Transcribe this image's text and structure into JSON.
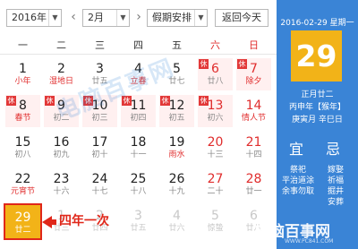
{
  "toolbar": {
    "year_value": "2016年",
    "prev_icon": "chevron-left-icon",
    "month_value": "2月",
    "next_icon": "chevron-right-icon",
    "holiday_value": "假期安排",
    "today_label": "返回今天"
  },
  "weekdays": [
    "一",
    "二",
    "三",
    "四",
    "五",
    "六",
    "日"
  ],
  "days": [
    [
      {
        "num": "1",
        "sub": "小年",
        "sub_red": true
      },
      {
        "num": "2",
        "sub": "湿地日",
        "sub_red": true
      },
      {
        "num": "3",
        "sub": "廿五"
      },
      {
        "num": "4",
        "sub": "立春",
        "sub_red": true
      },
      {
        "num": "5",
        "sub": "廿七"
      },
      {
        "num": "6",
        "sub": "廿八",
        "tag": "休",
        "weekend": true,
        "holiday": true
      },
      {
        "num": "7",
        "sub": "除夕",
        "sub_red": true,
        "tag": "休",
        "weekend": true,
        "holiday": true
      }
    ],
    [
      {
        "num": "8",
        "sub": "春节",
        "sub_red": true,
        "tag": "休",
        "holiday": true
      },
      {
        "num": "9",
        "sub": "初二",
        "tag": "休",
        "holiday": true
      },
      {
        "num": "10",
        "sub": "初三",
        "tag": "休",
        "holiday": true
      },
      {
        "num": "11",
        "sub": "初四",
        "tag": "休",
        "holiday": true
      },
      {
        "num": "12",
        "sub": "初五",
        "tag": "休",
        "holiday": true
      },
      {
        "num": "13",
        "sub": "初六",
        "tag": "休",
        "weekend": true,
        "holiday": true
      },
      {
        "num": "14",
        "sub": "情人节",
        "sub_red": true,
        "weekend": true
      }
    ],
    [
      {
        "num": "15",
        "sub": "初八"
      },
      {
        "num": "16",
        "sub": "初九"
      },
      {
        "num": "17",
        "sub": "初十"
      },
      {
        "num": "18",
        "sub": "十一"
      },
      {
        "num": "19",
        "sub": "雨水",
        "sub_red": true
      },
      {
        "num": "20",
        "sub": "十三",
        "weekend": true
      },
      {
        "num": "21",
        "sub": "十四",
        "weekend": true
      }
    ],
    [
      {
        "num": "22",
        "sub": "元宵节",
        "sub_red": true
      },
      {
        "num": "23",
        "sub": "十六"
      },
      {
        "num": "24",
        "sub": "十七"
      },
      {
        "num": "25",
        "sub": "十八"
      },
      {
        "num": "26",
        "sub": "十九"
      },
      {
        "num": "27",
        "sub": "二十",
        "weekend": true
      },
      {
        "num": "28",
        "sub": "廿一",
        "weekend": true
      }
    ],
    [
      {
        "num": "29",
        "sub": "廿二",
        "today": true
      },
      {
        "num": "1",
        "sub": "廿三",
        "grey": true
      },
      {
        "num": "2",
        "sub": "廿四",
        "grey": true
      },
      {
        "num": "3",
        "sub": "廿五",
        "grey": true
      },
      {
        "num": "4",
        "sub": "廿六",
        "grey": true
      },
      {
        "num": "5",
        "sub": "惊蛰",
        "grey": true
      },
      {
        "num": "6",
        "sub": "廿八",
        "grey": true
      }
    ]
  ],
  "annotation": "四年一次",
  "watermark": "电脑百事网",
  "watermark_url": "WWW.PC841.COM",
  "side": {
    "date_line": "2016-02-29 星期一",
    "big_day": "29",
    "lunar": "正月廿二",
    "ganzhi_year": "丙申年【猴年】",
    "ganzhi_md": "庚寅月 辛巳日",
    "yi_label": "宜",
    "ji_label": "忌",
    "yi_items": [
      "祭祀",
      "平治道涂",
      "余事勿取"
    ],
    "ji_items": [
      "嫁娶",
      "祈福",
      "掘井",
      "安葬"
    ]
  },
  "colors": {
    "accent": "#3a84d6",
    "today": "#f2b318",
    "holiday_bg": "#fff0f0",
    "red": "#e02d2d"
  }
}
